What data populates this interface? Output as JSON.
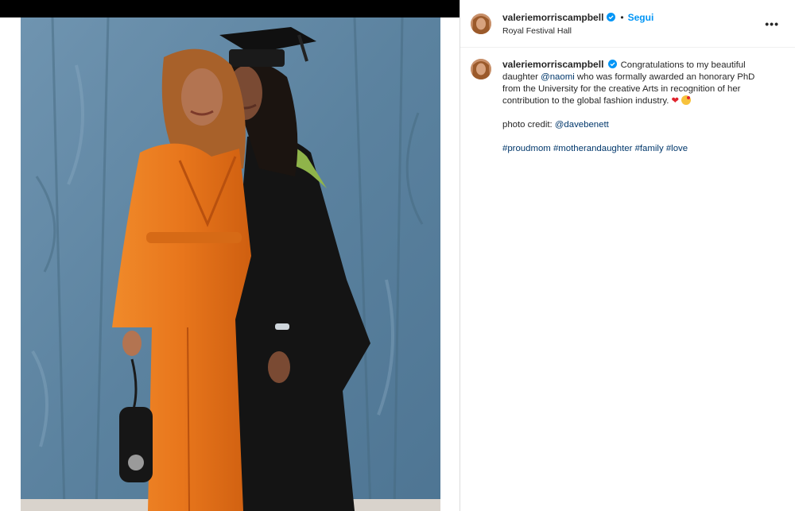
{
  "post": {
    "username": "valeriemorriscampbell",
    "dot": "•",
    "follow_label": "Segui",
    "location": "Royal Festival Hall",
    "more_label": "•••"
  },
  "caption": {
    "username": "valeriemorriscampbell",
    "text_1": " Congratulations to my beautiful daughter ",
    "mention_1": "@naomi",
    "text_2": " who was formally awarded an honorary PhD from the University for the creative Arts in recognition of her contribution to the global fashion industry. ",
    "heart": "❤",
    "credit_label": "photo credit: ",
    "mention_2": "@davebenett",
    "hashtags": [
      "#proudmom",
      "#motherandaughter",
      "#family",
      "#love"
    ]
  },
  "colors": {
    "accent_blue": "#0095f6",
    "link_blue": "#00376b",
    "backdrop_blue": "#5f86a3",
    "suit_orange": "#e8761c",
    "gown_black": "#141414"
  },
  "icons": {
    "verified": "verified-badge-icon",
    "more": "more-options-icon"
  }
}
